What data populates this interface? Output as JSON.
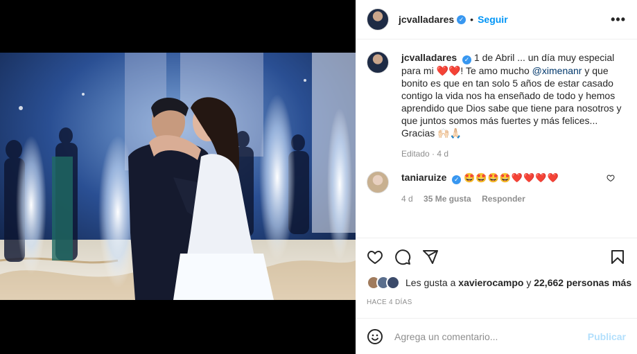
{
  "post": {
    "username": "jcvalladares",
    "follow_label": "Seguir",
    "more_label": "•••"
  },
  "caption": {
    "username": "jcvalladares",
    "text_before_mention": "1 de Abril ... un día muy especial para mi ❤️❤️! Te amo mucho ",
    "mention": "@ximenanr",
    "text_after_mention": " y que bonito es que en tan solo 5 años de estar casado contigo la vida nos ha enseñado de todo y hemos aprendido que Dios sabe que tiene para nosotros y que juntos somos más fuertes y más felices... Gracias 🙌🏻🙏🏻",
    "meta": "Editado · 4 d"
  },
  "comment": {
    "username": "taniaruize",
    "text": "🤩🤩🤩🤩❤️❤️❤️❤️",
    "time": "4 d",
    "likes": "35 Me gusta",
    "reply_label": "Responder"
  },
  "likes": {
    "prefix": "Les gusta a ",
    "first_user": "xavierocampo",
    "middle": " y ",
    "count": "22,662 personas más"
  },
  "timestamp": "HACE 4 DÍAS",
  "add_comment": {
    "placeholder": "Agrega un comentario...",
    "publish_label": "Publicar"
  },
  "colors": {
    "accent": "#0095f6",
    "verified": "#3897f0",
    "publish_disabled": "#b2dffc"
  },
  "icons": [
    "heart-icon",
    "comment-icon",
    "share-icon",
    "bookmark-icon",
    "emoji-icon",
    "verified-icon",
    "more-icon"
  ]
}
